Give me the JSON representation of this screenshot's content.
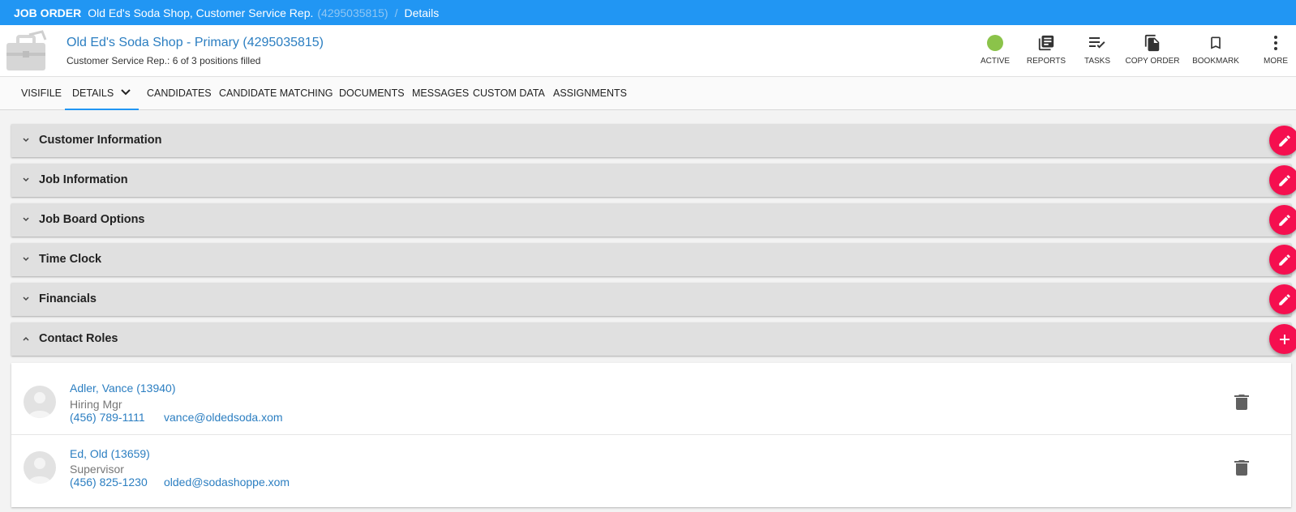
{
  "breadcrumb": {
    "type": "JOB ORDER",
    "name": "Old Ed's Soda Shop, Customer Service Rep.",
    "id": "(4295035815)",
    "separator": "/",
    "page": "Details"
  },
  "header": {
    "title": "Old Ed's Soda Shop - Primary (4295035815)",
    "subtitle": "Customer Service Rep.: 6 of 3 positions filled",
    "status_color": "#8bc34a",
    "actions": [
      {
        "label": "ACTIVE",
        "icon": "status-dot-icon"
      },
      {
        "label": "REPORTS",
        "icon": "reports-icon"
      },
      {
        "label": "TASKS",
        "icon": "tasks-icon"
      },
      {
        "label": "COPY ORDER",
        "icon": "copy-icon"
      },
      {
        "label": "BOOKMARK",
        "icon": "bookmark-icon"
      },
      {
        "label": "MORE",
        "icon": "more-vertical-icon"
      }
    ]
  },
  "tabs": [
    {
      "label": "VISIFILE"
    },
    {
      "label": "DETAILS",
      "active": true
    },
    {
      "label": "CANDIDATES"
    },
    {
      "label": "CANDIDATE MATCHING"
    },
    {
      "label": "DOCUMENTS"
    },
    {
      "label": "MESSAGES"
    },
    {
      "label": "CUSTOM DATA"
    },
    {
      "label": "ASSIGNMENTS"
    }
  ],
  "sections": [
    {
      "title": "Customer Information",
      "expanded": false,
      "action": "edit"
    },
    {
      "title": "Job Information",
      "expanded": false,
      "action": "edit"
    },
    {
      "title": "Job Board Options",
      "expanded": false,
      "action": "edit"
    },
    {
      "title": "Time Clock",
      "expanded": false,
      "action": "edit"
    },
    {
      "title": "Financials",
      "expanded": false,
      "action": "edit"
    },
    {
      "title": "Contact Roles",
      "expanded": true,
      "action": "add"
    }
  ],
  "contacts": [
    {
      "name": "Adler, Vance (13940)",
      "role": "Hiring Mgr",
      "phone": "(456) 789-1111",
      "email": "vance@oldedsoda.xom"
    },
    {
      "name": "Ed, Old (13659)",
      "role": "Supervisor",
      "phone": "(456) 825-1230",
      "email": "olded@sodashoppe.xom"
    }
  ],
  "colors": {
    "topbar": "#2196f3",
    "link": "#2b7ec1",
    "fab": "#f50f4f",
    "active": "#8bc34a"
  }
}
